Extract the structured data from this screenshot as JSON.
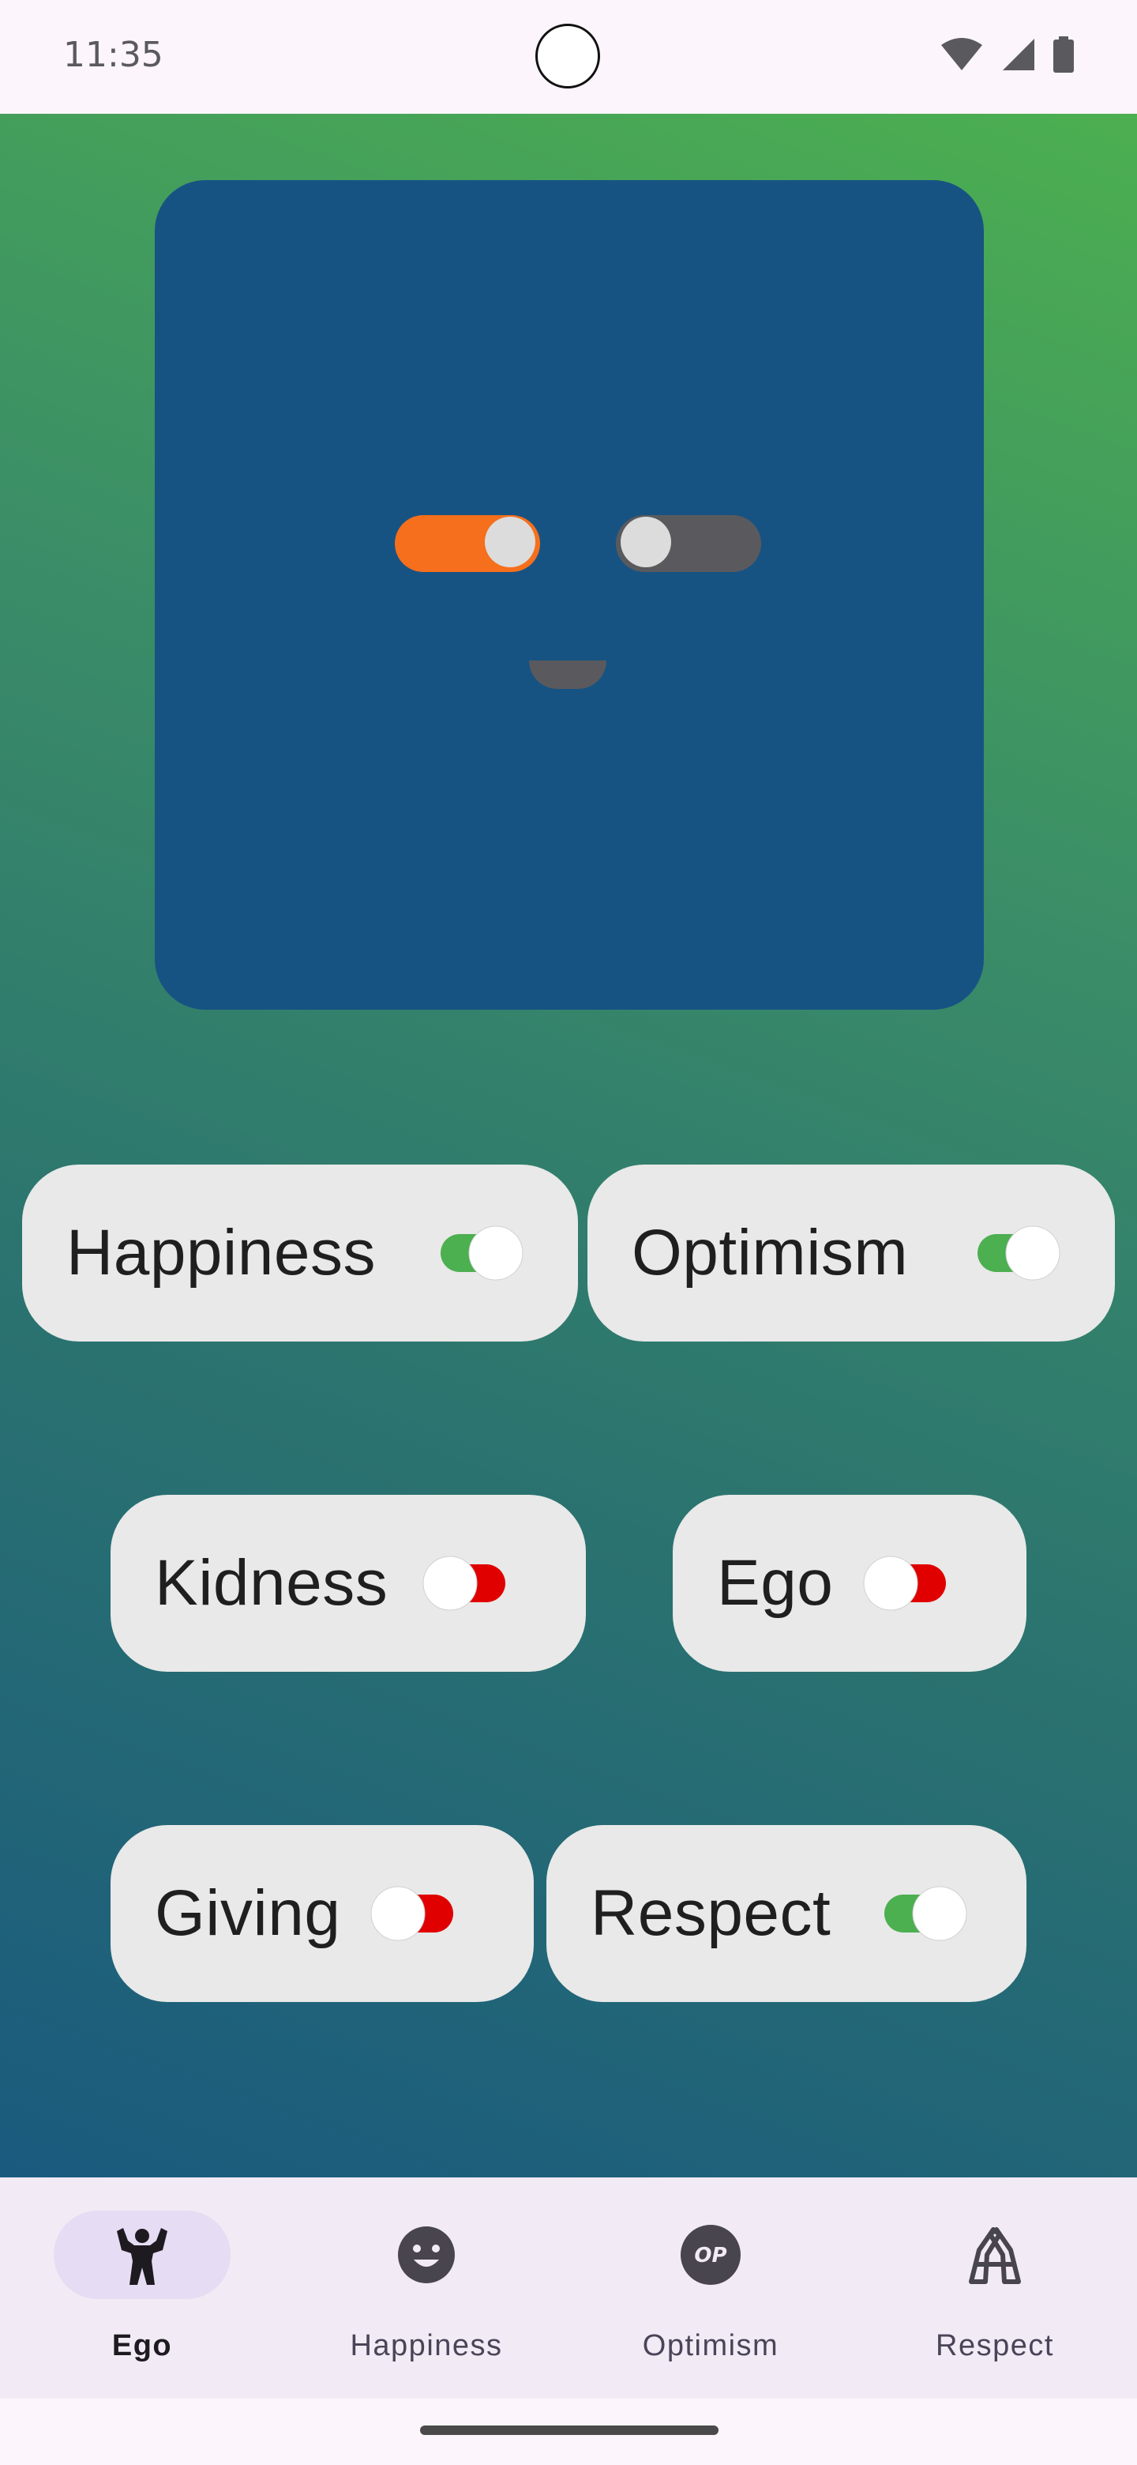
{
  "status_bar": {
    "time": "11:35",
    "icons": [
      "wifi-icon",
      "cell-signal-icon",
      "battery-icon"
    ]
  },
  "face": {
    "background_color": "#175382",
    "left_eye": {
      "state": "on",
      "track_color": "#f56f1c"
    },
    "right_eye": {
      "state": "off",
      "track_color": "#5a5a5e"
    },
    "mouth_color": "#5a5a5e"
  },
  "traits": [
    {
      "label": "Happiness",
      "checked": true
    },
    {
      "label": "Optimism",
      "checked": true
    },
    {
      "label": "Kidness",
      "checked": false
    },
    {
      "label": "Ego",
      "checked": false
    },
    {
      "label": "Giving",
      "checked": false
    },
    {
      "label": "Respect",
      "checked": true
    }
  ],
  "switch_colors": {
    "on_track": "#4caf50",
    "off_track": "#e00000",
    "thumb": "#ffffff"
  },
  "bottom_nav": {
    "items": [
      {
        "label": "Ego",
        "icon": "flexing-person-icon",
        "active": true
      },
      {
        "label": "Happiness",
        "icon": "smiley-face-icon",
        "active": false
      },
      {
        "label": "Optimism",
        "icon": "op-badge-icon",
        "active": false
      },
      {
        "label": "Respect",
        "icon": "handshake-icon",
        "active": false
      }
    ]
  }
}
